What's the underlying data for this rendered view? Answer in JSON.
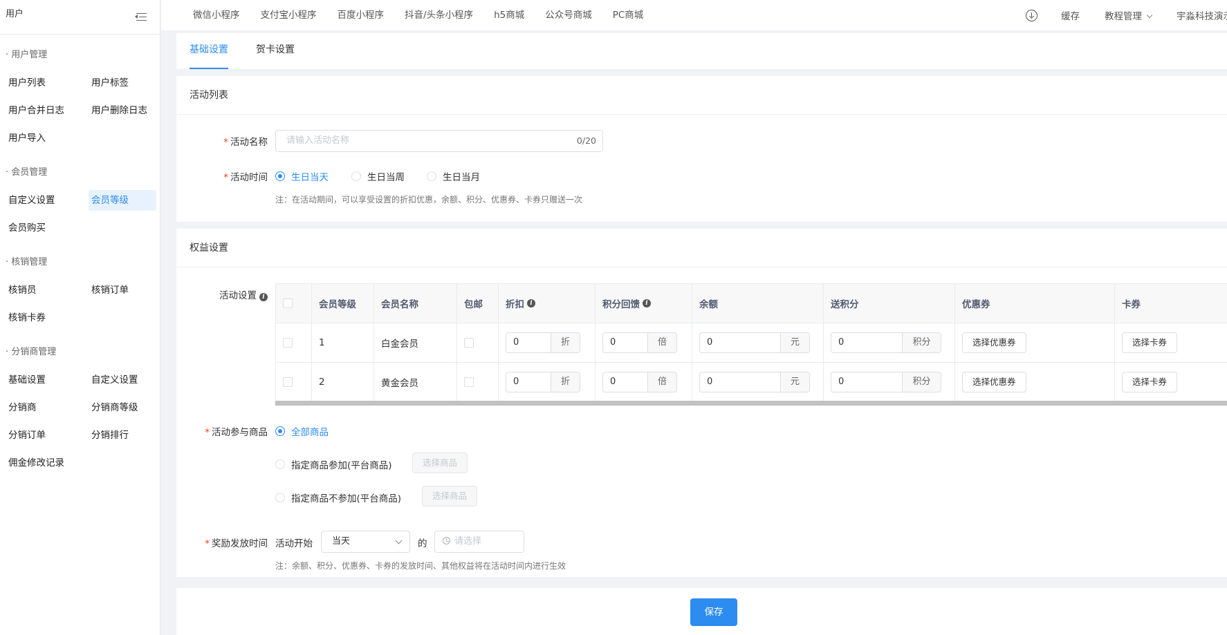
{
  "sidebar": {
    "title": "用户",
    "groups": [
      {
        "title": "· 用户管理",
        "items": [
          "用户列表",
          "用户标签",
          "用户合并日志",
          "用户删除日志",
          "用户导入"
        ]
      },
      {
        "title": "· 会员管理",
        "items": [
          "自定义设置",
          "会员等级",
          "会员购买"
        ]
      },
      {
        "title": "· 核销管理",
        "items": [
          "核销员",
          "核销订单",
          "核销卡券"
        ]
      },
      {
        "title": "· 分销商管理",
        "items": [
          "基础设置",
          "自定义设置",
          "分销商",
          "分销商等级",
          "分销订单",
          "分销排行",
          "佣金修改记录"
        ]
      }
    ],
    "active_item": "会员等级"
  },
  "topnav": [
    "微信小程序",
    "支付宝小程序",
    "百度小程序",
    "抖音/头条小程序",
    "h5商城",
    "公众号商城",
    "PC商城"
  ],
  "topright": {
    "cache": "缓存",
    "tutorial": "教程管理",
    "user": "宇淼科技演示"
  },
  "tabs": [
    "基础设置",
    "贺卡设置"
  ],
  "activity_card": {
    "title": "活动列表",
    "name_label": "活动名称",
    "name_placeholder": "请输入活动名称",
    "name_count": "0/20",
    "time_label": "活动时间",
    "time_options": [
      "生日当天",
      "生日当周",
      "生日当月"
    ],
    "time_note": "注：在活动期间，可以享受设置的折扣优惠，余额、积分、优惠券、卡券只赠送一次"
  },
  "rights_card": {
    "title": "权益设置",
    "settings_label": "活动设置",
    "columns": [
      "会员等级",
      "会员名称",
      "包邮",
      "折扣",
      "积分回馈",
      "余额",
      "送积分",
      "优惠券",
      "卡券"
    ],
    "rows": [
      {
        "level": "1",
        "name": "白金会员",
        "discount": "0",
        "discount_unit": "折",
        "points_back": "0",
        "points_unit": "倍",
        "balance": "0",
        "balance_unit": "元",
        "give_points": "0",
        "give_unit": "积分",
        "coupon_btn": "选择优惠券",
        "card_btn": "选择卡券"
      },
      {
        "level": "2",
        "name": "黄金会员",
        "discount": "0",
        "discount_unit": "折",
        "points_back": "0",
        "points_unit": "倍",
        "balance": "0",
        "balance_unit": "元",
        "give_points": "0",
        "give_unit": "积分",
        "coupon_btn": "选择优惠券",
        "card_btn": "选择卡券"
      }
    ],
    "goods_label": "活动参与商品",
    "goods_options": [
      "全部商品",
      "指定商品参加(平台商品)",
      "指定商品不参加(平台商品)"
    ],
    "select_goods_btn": "选择商品",
    "reward_label": "奖励发放时间",
    "reward_prefix": "活动开始",
    "reward_select": "当天",
    "reward_of": "的",
    "reward_time_placeholder": "请选择",
    "reward_note": "注：余额、积分、优惠券、卡券的发放时间、其他权益将在活动时间内进行生效"
  },
  "save_label": "保存",
  "colors": {
    "accent": "#2d8cf0",
    "required": "#ed4014"
  }
}
